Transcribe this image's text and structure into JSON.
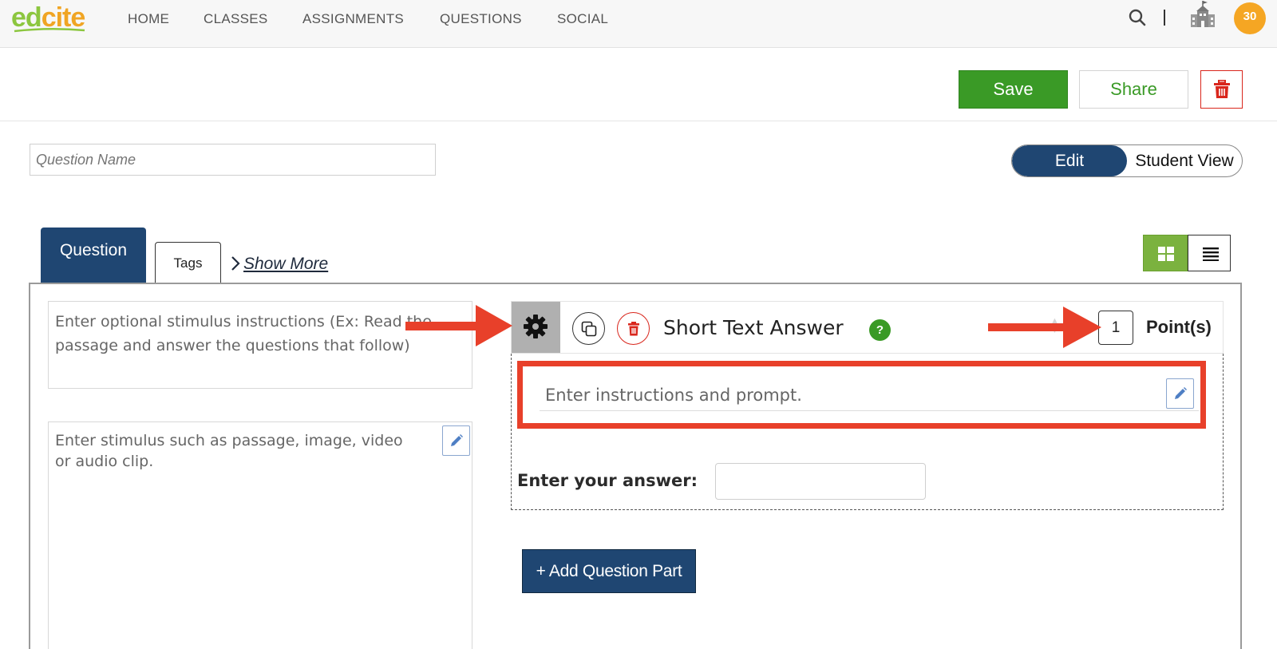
{
  "brand": {
    "logo_part1": "ed",
    "logo_part2": "cite"
  },
  "nav": {
    "items": [
      "HOME",
      "CLASSES",
      "ASSIGNMENTS",
      "QUESTIONS",
      "SOCIAL"
    ],
    "avatar_count": "30",
    "icons": [
      "search-icon",
      "school-icon"
    ]
  },
  "toolbar": {
    "save_label": "Save",
    "share_label": "Share",
    "delete_icon": "trash-icon"
  },
  "question_name": {
    "placeholder": "Question Name",
    "value": ""
  },
  "view_toggle": {
    "edit_label": "Edit",
    "student_label": "Student View",
    "selected": "Edit"
  },
  "tabs": {
    "question_label": "Question",
    "tags_label": "Tags",
    "show_more_label": "Show More"
  },
  "layout_buttons": {
    "grid_icon": "grid-icon",
    "list_icon": "list-icon",
    "selected": "grid"
  },
  "stimulus": {
    "instructions_placeholder": "Enter optional stimulus instructions (Ex: Read the passage and answer the questions that follow)",
    "content_placeholder": "Enter stimulus such as passage, image, video or audio clip."
  },
  "question_part": {
    "type_label": "Short Text Answer",
    "help_label": "?",
    "points_value": "1",
    "points_label": "Point(s)",
    "prompt_placeholder": "Enter instructions and prompt.",
    "answer_label": "Enter your answer:",
    "answer_value": ""
  },
  "add_part_label": "+ Add Question Part",
  "colors": {
    "brand_green": "#3a9a26",
    "navy": "#1f4672",
    "danger_red": "#d9261c",
    "annotation_red": "#e8402a",
    "avatar_orange": "#f5a623"
  }
}
